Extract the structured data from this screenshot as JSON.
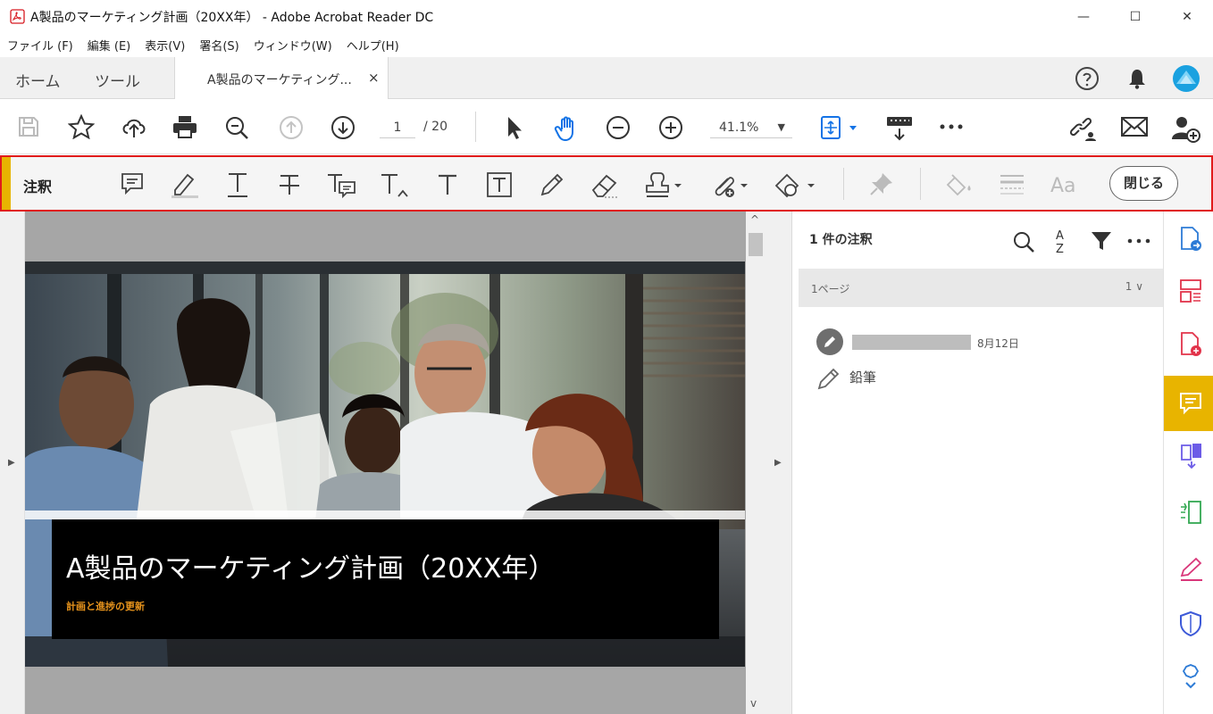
{
  "window": {
    "title": "A製品のマーケティング計画（20XX年） - Adobe Acrobat Reader DC",
    "controls": [
      "—",
      "☐",
      "✕"
    ]
  },
  "menu": [
    "ファイル (F)",
    "編集 (E)",
    "表示(V)",
    "署名(S)",
    "ウィンドウ(W)",
    "ヘルプ(H)"
  ],
  "tabs": {
    "home": "ホーム",
    "tools": "ツール",
    "document": "A製品のマーケティング...",
    "close": "×"
  },
  "toolbar": {
    "page_current": "1",
    "page_total": "/ 20",
    "zoom": "41.1%",
    "zoom_caret": "▼"
  },
  "comment_toolbar": {
    "label": "注釈",
    "close_button": "閉じる"
  },
  "document": {
    "title": "A製品のマーケティング計画（20XX年）",
    "subtitle": "計画と進捗の更新"
  },
  "comments_panel": {
    "header": "1 件の注釈",
    "page_label": "1ページ",
    "page_count": "1 ∨",
    "entry": {
      "date": "8月12日",
      "type": "鉛筆"
    }
  },
  "scroll": {
    "up": "^",
    "down": "v"
  },
  "panel_toggles": {
    "left": "▶",
    "right": "▶"
  },
  "colors": {
    "accent": "#e8b400",
    "highlight_border": "#e01b1b",
    "subtitle": "#e8941c"
  }
}
